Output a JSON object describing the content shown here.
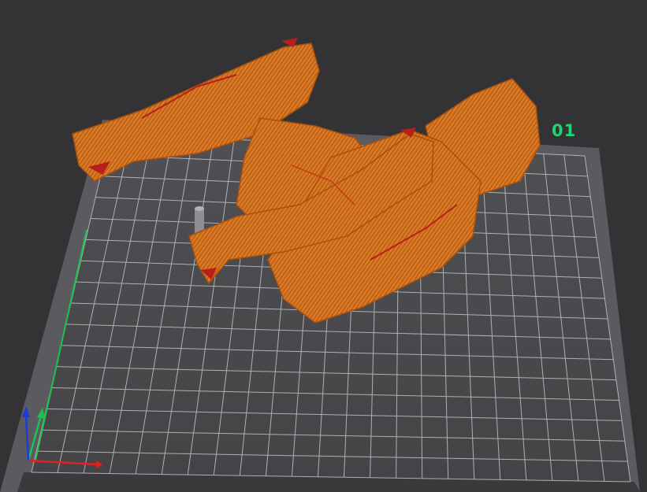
{
  "plate": {
    "label": "01",
    "label_color": "#22d36e",
    "bed_color": "#4a4a4d",
    "grid_color": "#bfc3c6",
    "border_color": "#5b5b5f"
  },
  "model": {
    "name": "figure-model",
    "color": "#c8621a",
    "overhang_color": "#b81f18"
  },
  "axes": {
    "x_color": "#e02020",
    "y_color": "#19c24f",
    "z_color": "#1a3cd8"
  },
  "viewport": {
    "background": "#333335"
  }
}
